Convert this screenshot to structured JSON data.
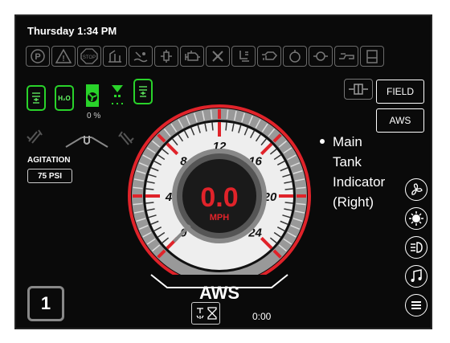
{
  "header": {
    "datetime": "Thursday 1:34 PM"
  },
  "warning_icons": [
    "parking-brake-icon",
    "warning-triangle-icon",
    "stop-icon",
    "boom-icon",
    "fluid-icon",
    "hydraulic-icon",
    "engine-icon",
    "fan-icon",
    "seat-icon",
    "oil-icon",
    "coolant-icon",
    "filter-icon",
    "fuel-icon"
  ],
  "tanks": {
    "left_label": "",
    "water_label": "H₂O",
    "pump_percent": "0 %"
  },
  "mode_buttons": {
    "field": "FIELD",
    "aws": "AWS"
  },
  "callout": {
    "lines": [
      "Main",
      "Tank",
      "Indicator",
      "(Right)"
    ]
  },
  "agitation": {
    "label": "AGITATION",
    "value": "75 PSI"
  },
  "gear": "1",
  "gauge": {
    "value": "0.0",
    "unit": "MPH",
    "min": 0,
    "max": 24,
    "reading": 0,
    "ticks": [
      "0",
      "4",
      "8",
      "12",
      "16",
      "20",
      "24"
    ],
    "steering_mode": "AWS"
  },
  "timer": {
    "value": "0:00"
  },
  "right_icons": [
    "fan-icon",
    "lights-icon",
    "headlight-icon",
    "music-icon",
    "menu-icon"
  ],
  "colors": {
    "accent_green": "#29d32a",
    "accent_red": "#e0232a"
  }
}
